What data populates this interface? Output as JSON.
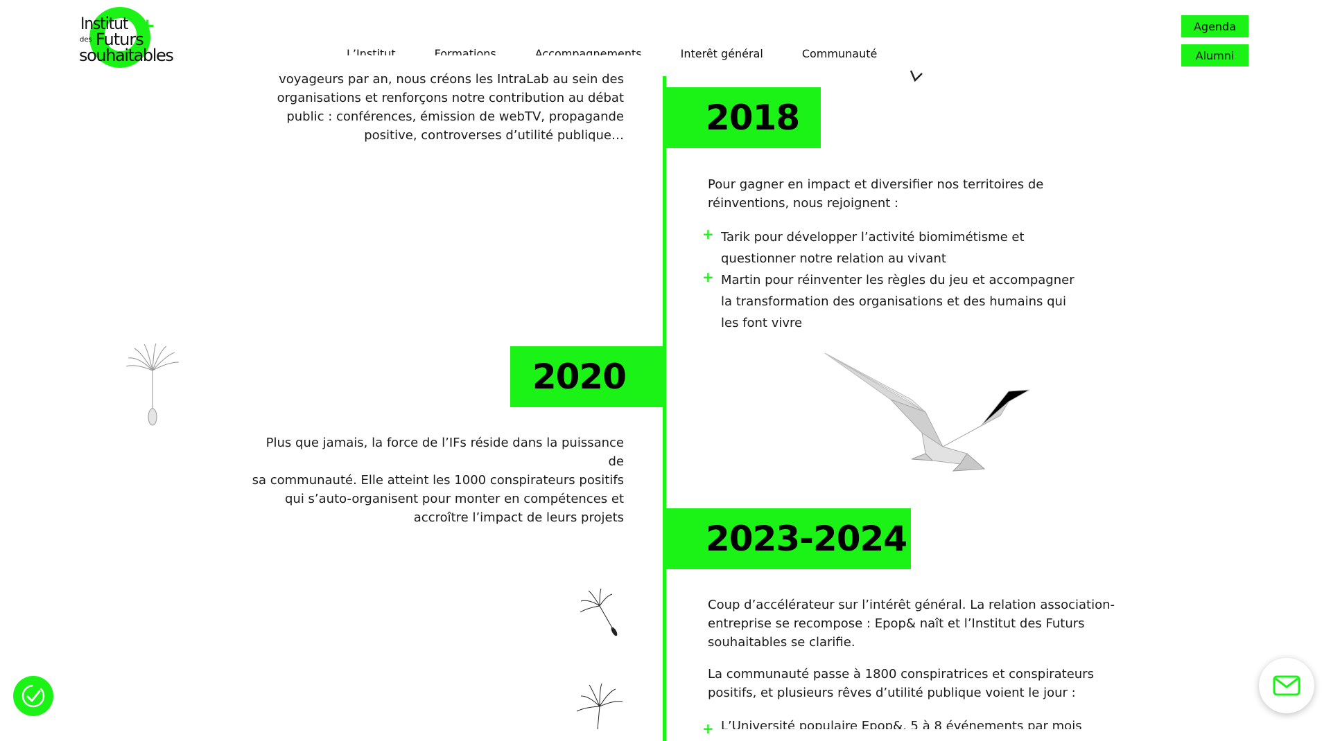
{
  "logo": {
    "line1": "Institut",
    "line2_small": "des",
    "line2": "Futurs",
    "line3": "souhaitables",
    "plus": "+"
  },
  "nav": {
    "items": [
      {
        "label": "L’Institut"
      },
      {
        "label": "Formations"
      },
      {
        "label": "Accompagnements"
      },
      {
        "label": "Interêt général"
      },
      {
        "label": "Communauté"
      }
    ]
  },
  "top_buttons": {
    "agenda": "Agenda",
    "alumni": "Alumni"
  },
  "timeline": {
    "intro_lines": [
      "voyageurs par an, nous créons les IntraLab au sein des",
      "organisations et renforçons notre contribution au débat",
      "public : conférences, émission de webTV, propagande",
      "positive, controverses d’utilité publique…"
    ],
    "y2018": {
      "year": "2018",
      "text_lines": [
        "Pour gagner en impact et diversifier nos territoires de",
        "réinventions, nous rejoignent :"
      ],
      "bullets": [
        [
          "Tarik pour développer l’activité biomimétisme et",
          "questionner notre relation au vivant"
        ],
        [
          "Martin pour réinventer les règles du jeu et accompagner",
          "la transformation des organisations et des humains qui",
          "les font vivre"
        ]
      ]
    },
    "y2020": {
      "year": "2020",
      "text_lines": [
        "Plus que jamais, la force de l’IFs réside dans la puissance de",
        "sa communauté. Elle atteint les 1000 conspirateurs positifs",
        "qui s’auto-organisent pour monter en compétences et",
        "accroître l’impact de leurs projets"
      ]
    },
    "y2023": {
      "year": "2023-2024",
      "p1_lines": [
        "Coup d’accélérateur sur l’intérêt général. La relation association-",
        "entreprise se recompose : Epop& naît et l’Institut des Futurs",
        "souhaitables se clarifie."
      ],
      "p2_lines": [
        "La communauté passe à 1800 conspiratrices et conspirateurs",
        "positifs, et plusieurs rêves d’utilité publique voient le jour :"
      ],
      "bullet_partial": "L’Université populaire Epop&, 5 à 8 événements par mois"
    }
  },
  "colors": {
    "accent": "#1bf216"
  }
}
